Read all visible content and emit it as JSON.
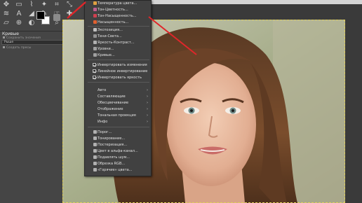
{
  "toolbox": {
    "tools": [
      {
        "name": "move-tool-icon",
        "glyph": "✥"
      },
      {
        "name": "rect-select-tool-icon",
        "glyph": "▭"
      },
      {
        "name": "free-select-tool-icon",
        "glyph": "⌇"
      },
      {
        "name": "fuzzy-select-tool-icon",
        "glyph": "✦"
      },
      {
        "name": "crop-tool-icon",
        "glyph": "⌗"
      },
      {
        "name": "transform-tool-icon",
        "glyph": "⤡"
      },
      {
        "name": "warp-tool-icon",
        "glyph": "≋"
      },
      {
        "name": "text-tool-icon",
        "glyph": "A"
      },
      {
        "name": "bucket-fill-tool-icon",
        "glyph": "◢"
      },
      {
        "name": "pencil-tool-icon",
        "glyph": "✎"
      },
      {
        "name": "smudge-tool-icon",
        "glyph": "☞"
      },
      {
        "name": "heal-tool-icon",
        "glyph": "✚"
      },
      {
        "name": "eraser-tool-icon",
        "glyph": "▱"
      },
      {
        "name": "clone-tool-icon",
        "glyph": "⊕"
      },
      {
        "name": "dodge-tool-icon",
        "glyph": "◐"
      },
      {
        "name": "eyedropper-tool-icon",
        "glyph": "⌿"
      },
      {
        "name": "zoom-tool-icon",
        "glyph": "⌕"
      },
      {
        "name": "measure-tool-icon",
        "glyph": "⚲"
      }
    ],
    "dock": {
      "title": "Кривые",
      "row1": "Сохранить значения",
      "preset": "Рыше",
      "row3": "Создать пресы"
    }
  },
  "menu": {
    "items": [
      {
        "label": "Температура цвета...",
        "icon": "#e0a040"
      },
      {
        "label": "Тон-Цветность...",
        "icon": "#c06090"
      },
      {
        "label": "Тон-Насыщенность...",
        "icon": "#d04050"
      },
      {
        "label": "Насыщенность...",
        "icon": "#e06030"
      },
      {
        "label": "Экспозиция...",
        "icon": "#c0c0c0"
      },
      {
        "label": "Тени-Света...",
        "icon": "#909090"
      },
      {
        "label": "Яркость-Контраст...",
        "icon": "#b0b0b0"
      },
      {
        "label": "Уровни...",
        "icon": "#a0a0a0"
      },
      {
        "label": "Кривые...",
        "icon": "#a0a0a0"
      },
      {
        "label": "Инвертировать изменения",
        "check": true
      },
      {
        "label": "Линейное инвертирование",
        "check": true
      },
      {
        "label": "Инвертировать яркость",
        "check": true
      },
      {
        "label": "Авто",
        "submenu": true
      },
      {
        "label": "Составляющие",
        "submenu": true
      },
      {
        "label": "Обесцвечивание",
        "submenu": true
      },
      {
        "label": "Отображение",
        "submenu": true
      },
      {
        "label": "Тональная проекция",
        "submenu": true
      },
      {
        "label": "Инфо",
        "submenu": true
      },
      {
        "label": "Порог...",
        "icon": "#b0b0b0"
      },
      {
        "label": "Тонирование...",
        "icon": "#b0b0b0"
      },
      {
        "label": "Постеризация...",
        "icon": "#b0b0b0"
      },
      {
        "label": "Цвет в альфа-канал...",
        "icon": "#b0b0b0"
      },
      {
        "label": "Подавлять шум...",
        "icon": "#b0b0b0"
      },
      {
        "label": "Обрезка RGB...",
        "icon": "#b0b0b0"
      },
      {
        "label": "«Горячие» цвета...",
        "icon": "#b0b0b0"
      }
    ]
  },
  "colors": {
    "menu_bg": "#414141",
    "annotation": "#e0262a",
    "selection": "#e2d15a"
  }
}
